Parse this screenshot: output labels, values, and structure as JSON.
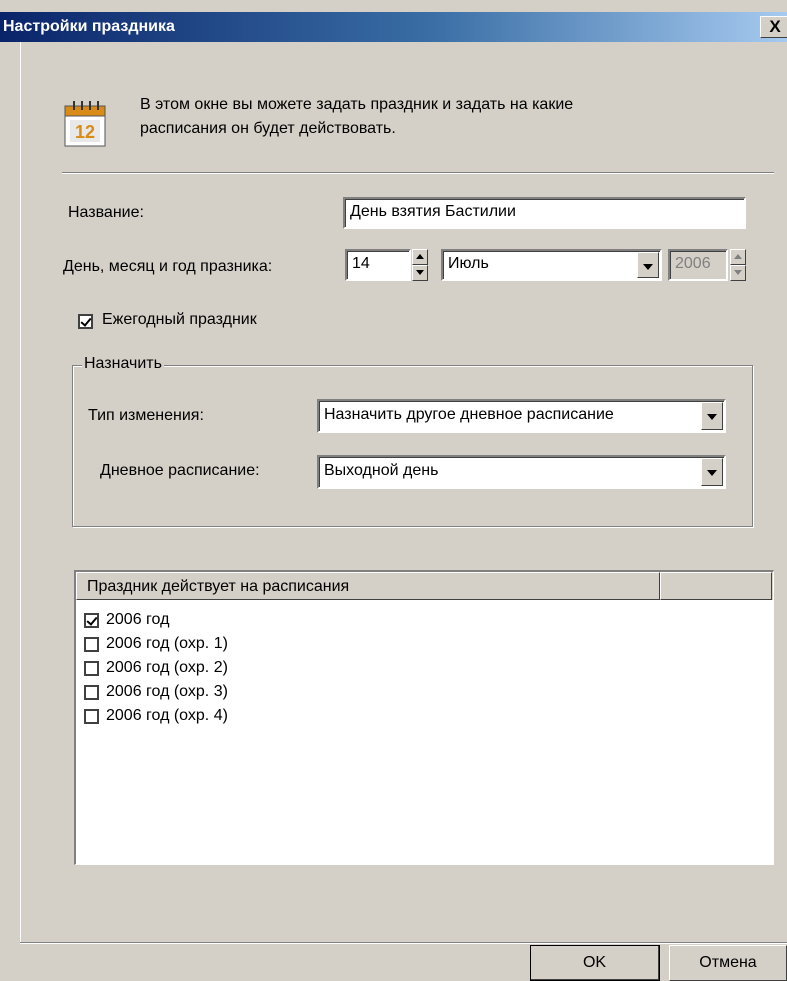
{
  "window": {
    "title": "Настройки праздника",
    "close_glyph": "X"
  },
  "info": {
    "icon": "calendar-12-icon",
    "icon_number": "12",
    "text_line1": "В этом окне вы можете задать праздник и задать на какие",
    "text_line2": "расписания он будет действовать."
  },
  "form": {
    "name_label": "Название:",
    "name_value": "День взятия Бастилии",
    "date_label": "День, месяц и год празника:",
    "day_value": "14",
    "month_value": "Июль",
    "year_value": "2006",
    "annual_label": "Ежегодный праздник",
    "annual_checked": true
  },
  "assign_group": {
    "title": "Назначить",
    "change_type_label": "Тип изменения:",
    "change_type_value": "Назначить другое дневное расписание",
    "daily_schedule_label": "Дневное расписание:",
    "daily_schedule_value": "Выходной день"
  },
  "schedules_list": {
    "header": "Праздник действует на расписания",
    "items": [
      {
        "label": "2006 год",
        "checked": true
      },
      {
        "label": "2006 год (охр. 1)",
        "checked": false
      },
      {
        "label": "2006 год (охр. 2)",
        "checked": false
      },
      {
        "label": "2006 год (охр. 3)",
        "checked": false
      },
      {
        "label": "2006 год (охр. 4)",
        "checked": false
      }
    ]
  },
  "buttons": {
    "ok": "OK",
    "cancel": "Отмена"
  },
  "colors": {
    "dialog_face": "#d4d0c8",
    "titlebar_start": "#0a246a",
    "titlebar_end": "#a6caf0",
    "calendar_accent": "#d98b18"
  }
}
